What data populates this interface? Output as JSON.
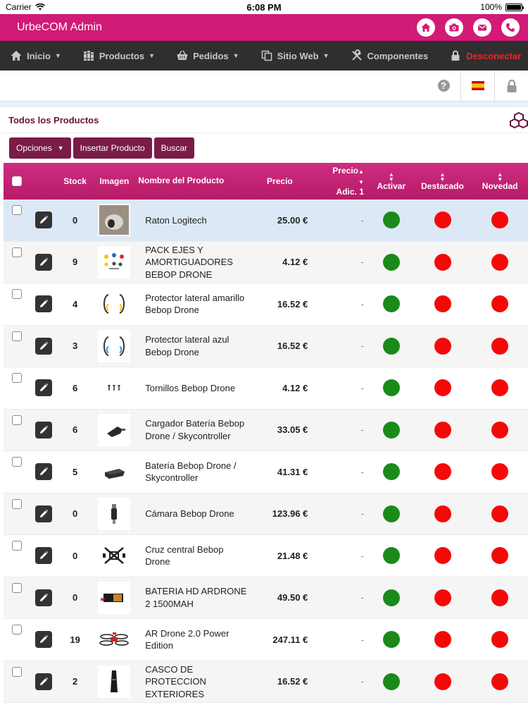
{
  "status_bar": {
    "carrier": "Carrier",
    "time": "6:08 PM",
    "battery": "100%"
  },
  "app": {
    "title": "UrbeCOM Admin",
    "brand_color": "#d21a77",
    "header_icons": [
      "home-icon",
      "camera-icon",
      "mail-icon",
      "phone-icon"
    ]
  },
  "nav": {
    "items": [
      {
        "label": "Inicio",
        "icon": "home-icon",
        "dropdown": true
      },
      {
        "label": "Productos",
        "icon": "books-icon",
        "dropdown": true
      },
      {
        "label": "Pedidos",
        "icon": "basket-icon",
        "dropdown": true
      },
      {
        "label": "Sitio Web",
        "icon": "copy-icon",
        "dropdown": true
      },
      {
        "label": "Componentes",
        "icon": "tools-icon",
        "dropdown": false
      },
      {
        "label": "Desconectar",
        "icon": "lock-icon",
        "dropdown": false
      }
    ]
  },
  "section": {
    "title": "Todos los Productos"
  },
  "actions": {
    "opciones": "Opciones",
    "insertar": "Insertar Producto",
    "buscar": "Buscar"
  },
  "table": {
    "headers": {
      "stock": "Stock",
      "imagen": "Imagen",
      "nombre": "Nombre del Producto",
      "precio": "Precio",
      "precio_adic_1": "Precio",
      "precio_adic_2": "Adic. 1",
      "activar": "Activar",
      "destacado": "Destacado",
      "novedad": "Novedad"
    },
    "rows": [
      {
        "stock": "0",
        "name": "Raton Logitech",
        "price": "25.00 €",
        "adic": "-",
        "activar": true,
        "destacado": false,
        "novedad": false,
        "thumb": "mouse"
      },
      {
        "stock": "9",
        "name": "PACK EJES Y AMORTIGUADORES BEBOP DRONE",
        "price": "4.12 €",
        "adic": "-",
        "activar": true,
        "destacado": false,
        "novedad": false,
        "thumb": "parts"
      },
      {
        "stock": "4",
        "name": "Protector lateral amarillo Bebop Drone",
        "price": "16.52 €",
        "adic": "-",
        "activar": true,
        "destacado": false,
        "novedad": false,
        "thumb": "protector-yellow"
      },
      {
        "stock": "3",
        "name": "Protector lateral azul Bebop Drone",
        "price": "16.52 €",
        "adic": "-",
        "activar": true,
        "destacado": false,
        "novedad": false,
        "thumb": "protector-blue"
      },
      {
        "stock": "6",
        "name": "Tornillos Bebop Drone",
        "price": "4.12 €",
        "adic": "-",
        "activar": true,
        "destacado": false,
        "novedad": false,
        "thumb": "screws"
      },
      {
        "stock": "6",
        "name": "Cargador Batería Bebop Drone / Skycontroller",
        "price": "33.05 €",
        "adic": "-",
        "activar": true,
        "destacado": false,
        "novedad": false,
        "thumb": "charger"
      },
      {
        "stock": "5",
        "name": "Batería Bebop Drone / Skycontroller",
        "price": "41.31 €",
        "adic": "-",
        "activar": true,
        "destacado": false,
        "novedad": false,
        "thumb": "battery"
      },
      {
        "stock": "0",
        "name": "Cámara Bebop Drone",
        "price": "123.96 €",
        "adic": "-",
        "activar": true,
        "destacado": false,
        "novedad": false,
        "thumb": "camera"
      },
      {
        "stock": "0",
        "name": "Cruz central Bebop Drone",
        "price": "21.48 €",
        "adic": "-",
        "activar": true,
        "destacado": false,
        "novedad": false,
        "thumb": "cross"
      },
      {
        "stock": "0",
        "name": "BATERIA HD ARDRONE 2 1500MAH",
        "price": "49.50 €",
        "adic": "-",
        "activar": true,
        "destacado": false,
        "novedad": false,
        "thumb": "hd-battery"
      },
      {
        "stock": "19",
        "name": "AR Drone 2.0 Power Edition",
        "price": "247.11 €",
        "adic": "-",
        "activar": true,
        "destacado": false,
        "novedad": false,
        "thumb": "drone"
      },
      {
        "stock": "2",
        "name": "CASCO DE PROTECCION EXTERIORES",
        "price": "16.52 €",
        "adic": "-",
        "activar": true,
        "destacado": false,
        "novedad": false,
        "thumb": "hull"
      }
    ]
  }
}
